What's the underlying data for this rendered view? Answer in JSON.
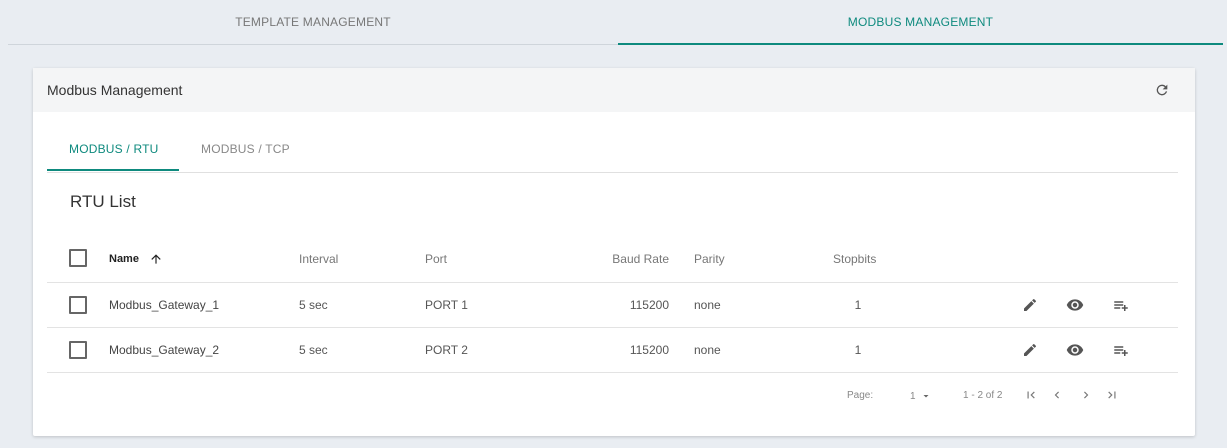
{
  "top_tabs": [
    {
      "label": "TEMPLATE MANAGEMENT"
    },
    {
      "label": "MODBUS MANAGEMENT"
    }
  ],
  "accent_color": "#0e8a7e",
  "card": {
    "title": "Modbus Management",
    "refresh_icon": "refresh-icon"
  },
  "subtabs": [
    {
      "label": "MODBUS / RTU"
    },
    {
      "label": "MODBUS / TCP"
    }
  ],
  "list_title": "RTU List",
  "table": {
    "columns": {
      "name": "Name",
      "interval": "Interval",
      "port": "Port",
      "baud": "Baud Rate",
      "parity": "Parity",
      "stopbits": "Stopbits"
    },
    "rows": [
      {
        "name": "Modbus_Gateway_1",
        "interval": "5 sec",
        "port": "PORT 1",
        "baud": "115200",
        "parity": "none",
        "stopbits": "1"
      },
      {
        "name": "Modbus_Gateway_2",
        "interval": "5 sec",
        "port": "PORT 2",
        "baud": "115200",
        "parity": "none",
        "stopbits": "1"
      }
    ]
  },
  "pager": {
    "page_label": "Page:",
    "page_value": "1",
    "range": "1 - 2 of 2"
  }
}
